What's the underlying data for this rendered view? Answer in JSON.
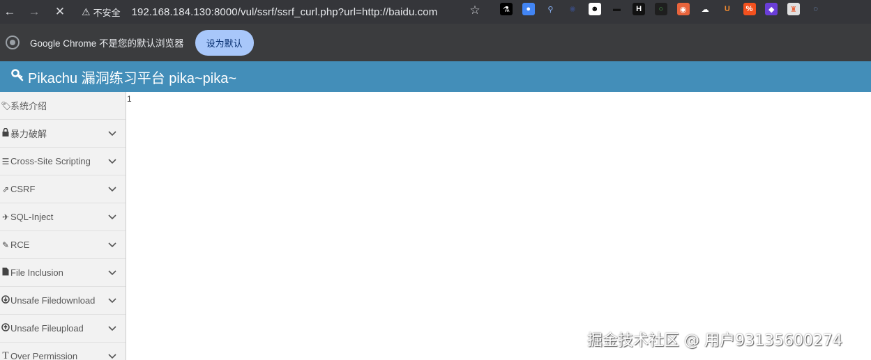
{
  "browser": {
    "nav": {
      "back": "←",
      "forward": "→",
      "stop": "✕",
      "star": "☆"
    },
    "security_icon": "⚠",
    "security_text": "不安全",
    "url": "192.168.184.130:8000/vul/ssrf/ssrf_curl.php?url=http://baidu.com",
    "extensions": [
      {
        "name": "flask-extension-icon",
        "glyph": "⚗",
        "color": "#000000",
        "fg": "#ffffff"
      },
      {
        "name": "map-pin-extension-icon",
        "glyph": "●",
        "color": "#4285f4",
        "fg": "#ffffff"
      },
      {
        "name": "pin-extension-icon",
        "glyph": "⚲",
        "color": "#35363a",
        "fg": "#8ab4f8"
      },
      {
        "name": "gear-extension-icon",
        "glyph": "✺",
        "color": "#35363a",
        "fg": "#3a4a7a"
      },
      {
        "name": "mask-extension-icon",
        "glyph": "☻",
        "color": "#ffffff",
        "fg": "#000000"
      },
      {
        "name": "hat-extension-icon",
        "glyph": "▬",
        "color": "#35363a",
        "fg": "#111111"
      },
      {
        "name": "h-extension-icon",
        "glyph": "H",
        "color": "#111111",
        "fg": "#ffffff"
      },
      {
        "name": "circle-extension-icon",
        "glyph": "○",
        "color": "#1e1e1e",
        "fg": "#4caf50"
      },
      {
        "name": "ring-extension-icon",
        "glyph": "◉",
        "color": "#e8643c",
        "fg": "#ffffff"
      },
      {
        "name": "cloud-extension-icon",
        "glyph": "☁",
        "color": "#35363a",
        "fg": "#ffffff"
      },
      {
        "name": "u-extension-icon",
        "glyph": "U",
        "color": "#35363a",
        "fg": "#f28b30"
      },
      {
        "name": "percent-extension-icon",
        "glyph": "%",
        "color": "#f4511e",
        "fg": "#ffffff"
      },
      {
        "name": "cube-extension-icon",
        "glyph": "◆",
        "color": "#6a3ed8",
        "fg": "#ffffff"
      },
      {
        "name": "tool-extension-icon",
        "glyph": "♜",
        "color": "#e0e0e0",
        "fg": "#e8643c"
      },
      {
        "name": "edge-extension-icon",
        "glyph": "◌",
        "color": "#35363a",
        "fg": "#8ab4f8"
      }
    ]
  },
  "infobar": {
    "message": "Google Chrome 不是您的默认浏览器",
    "button": "设为默认"
  },
  "site": {
    "title": "Pikachu 漏洞练习平台 pika~pika~",
    "header_color": "#438eb9"
  },
  "sidebar": {
    "items": [
      {
        "icon": "tags-icon",
        "glyph": "🏷",
        "label": "系统介绍",
        "expandable": false
      },
      {
        "icon": "lock-icon",
        "glyph": "🔒",
        "label": "暴力破解",
        "expandable": true
      },
      {
        "icon": "list-icon",
        "glyph": "☰",
        "label": "Cross-Site Scripting",
        "expandable": true
      },
      {
        "icon": "share-icon",
        "glyph": "⇗",
        "label": "CSRF",
        "expandable": true
      },
      {
        "icon": "fighter-jet-icon",
        "glyph": "✈",
        "label": "SQL-Inject",
        "expandable": true
      },
      {
        "icon": "pencil-icon",
        "glyph": "✎",
        "label": "RCE",
        "expandable": true
      },
      {
        "icon": "file-icon",
        "glyph": "▉",
        "label": "File Inclusion",
        "expandable": true
      },
      {
        "icon": "download-icon",
        "glyph": "⊕",
        "label": "Unsafe Filedownload",
        "expandable": true
      },
      {
        "icon": "upload-icon",
        "glyph": "⊕",
        "label": "Unsafe Fileupload",
        "expandable": true
      },
      {
        "icon": "text-icon",
        "glyph": "T",
        "label": "Over Permission",
        "expandable": true
      }
    ]
  },
  "content": {
    "result": "1"
  },
  "watermark": "掘金技术社区 @ 用户93135600274"
}
